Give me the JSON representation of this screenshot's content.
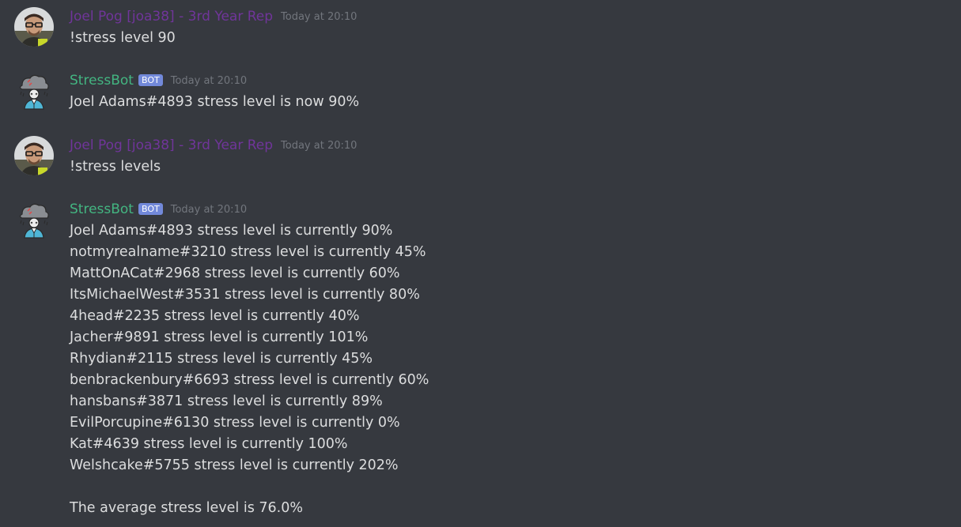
{
  "messages": [
    {
      "author": "Joel Pog [joa38] - 3rd Year Rep",
      "timestamp": "Today at 20:10",
      "lines": [
        "!stress level 90"
      ]
    },
    {
      "author": "StressBot",
      "badge": "BOT",
      "timestamp": "Today at 20:10",
      "lines": [
        "Joel Adams#4893 stress level is now 90%"
      ]
    },
    {
      "author": "Joel Pog [joa38] - 3rd Year Rep",
      "timestamp": "Today at 20:10",
      "lines": [
        "!stress levels"
      ]
    },
    {
      "author": "StressBot",
      "badge": "BOT",
      "timestamp": "Today at 20:10",
      "lines": [
        "Joel Adams#4893 stress level is currently 90%",
        "notmyrealname#3210 stress level is currently 45%",
        "MattOnACat#2968 stress level is currently 60%",
        "ItsMichaelWest#3531 stress level is currently 80%",
        "4head#2235 stress level is currently 40%",
        "Jacher#9891 stress level is currently 101%",
        "Rhydian#2115 stress level is currently 45%",
        "benbrackenbury#6693 stress level is currently 60%",
        "hansbans#3871 stress level is currently 89%",
        "EvilPorcupine#6130 stress level is currently 0%",
        "Kat#4639 stress level is currently 100%",
        "Welshcake#5755 stress level is currently 202%",
        "",
        "The average stress level is 76.0%"
      ]
    }
  ],
  "avatars": {
    "user": "user-avatar-icon",
    "bot": "stressbot-avatar-icon"
  },
  "colors": {
    "background": "#36393f",
    "user_name": "#70359a",
    "bot_name": "#43b581",
    "bot_badge": "#7289da",
    "timestamp": "#72767d",
    "text": "#dcddde"
  }
}
